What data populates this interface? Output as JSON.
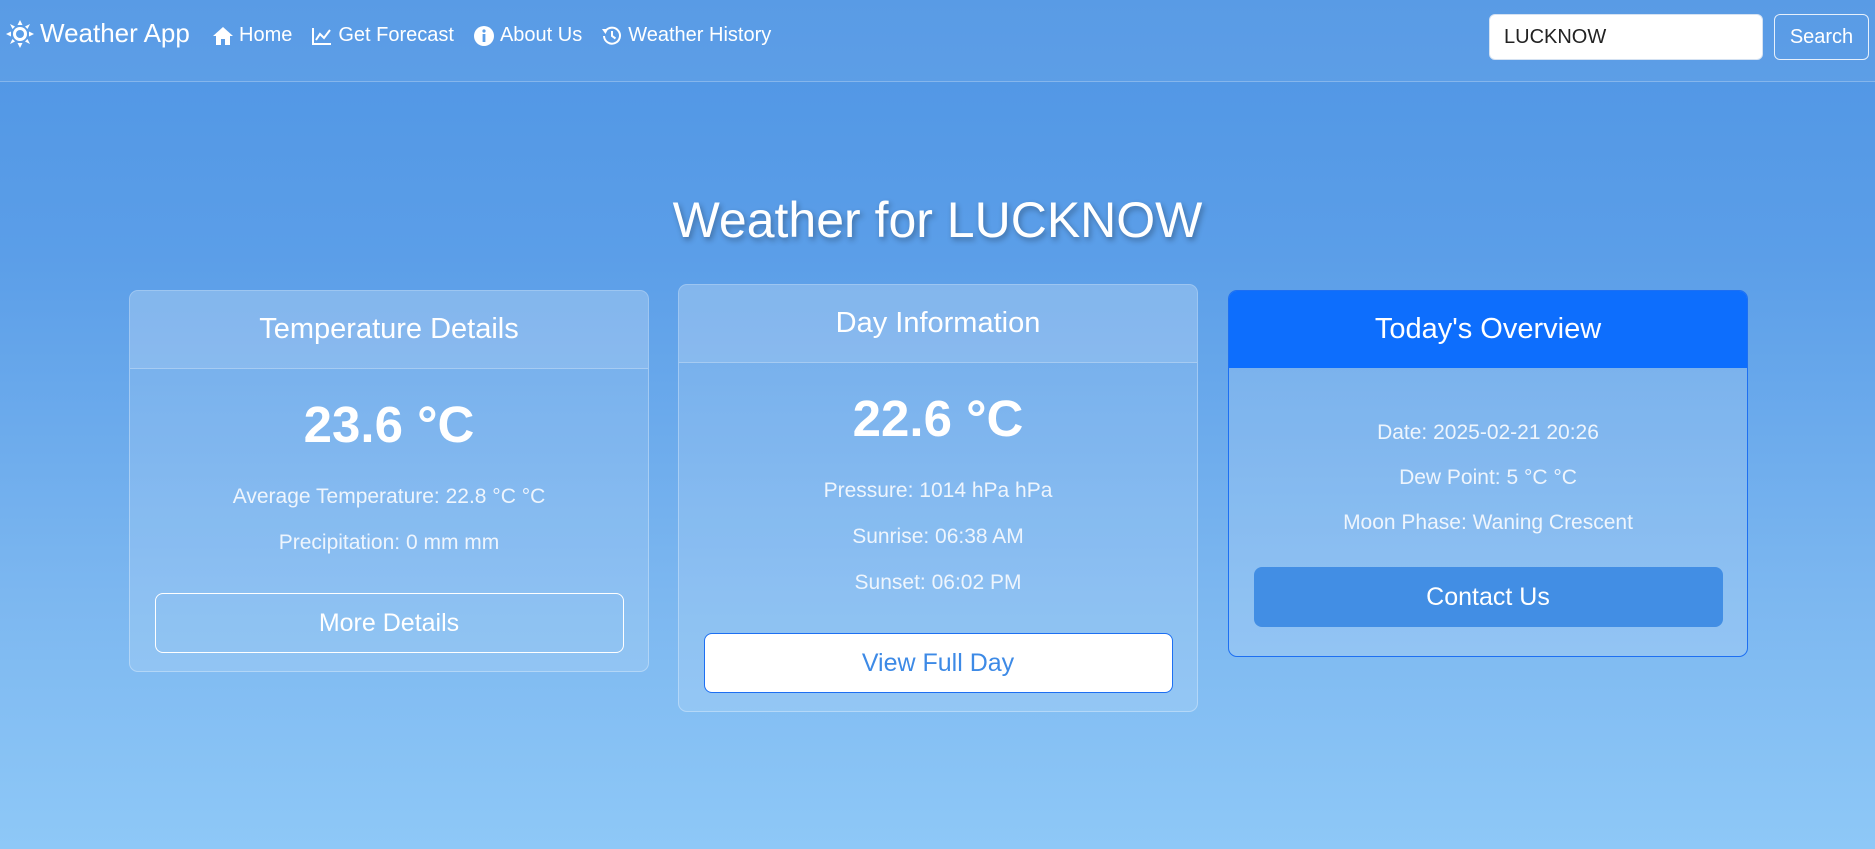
{
  "navbar": {
    "brand": "Weather App",
    "links": [
      {
        "label": "Home",
        "icon": "home-icon"
      },
      {
        "label": "Get Forecast",
        "icon": "chart-line-icon"
      },
      {
        "label": "About Us",
        "icon": "info-circle-icon"
      },
      {
        "label": "Weather History",
        "icon": "history-icon"
      }
    ],
    "search": {
      "value": "LUCKNOW",
      "button_label": "Search"
    }
  },
  "main": {
    "title": "Weather for LUCKNOW",
    "cards": [
      {
        "title": "Temperature Details",
        "temperature": "23.6 °C",
        "lines": [
          "Average Temperature: 22.8 °C °C",
          "Precipitation: 0 mm mm"
        ],
        "button_label": "More Details"
      },
      {
        "title": "Day Information",
        "temperature": "22.6 °C",
        "lines": [
          "Pressure: 1014 hPa hPa",
          "Sunrise: 06:38 AM",
          "Sunset: 06:02 PM"
        ],
        "button_label": "View Full Day"
      },
      {
        "title": "Today's Overview",
        "lines": [
          "Date: 2025-02-21 20:26",
          "Dew Point: 5 °C °C",
          "Moon Phase: Waning Crescent"
        ],
        "button_label": "Contact Us"
      }
    ]
  },
  "colors": {
    "background_top": "#4f95e4",
    "background_bottom": "#8ec8f7",
    "overview_header": "#0d6efd",
    "contact_button": "#428ee4"
  }
}
